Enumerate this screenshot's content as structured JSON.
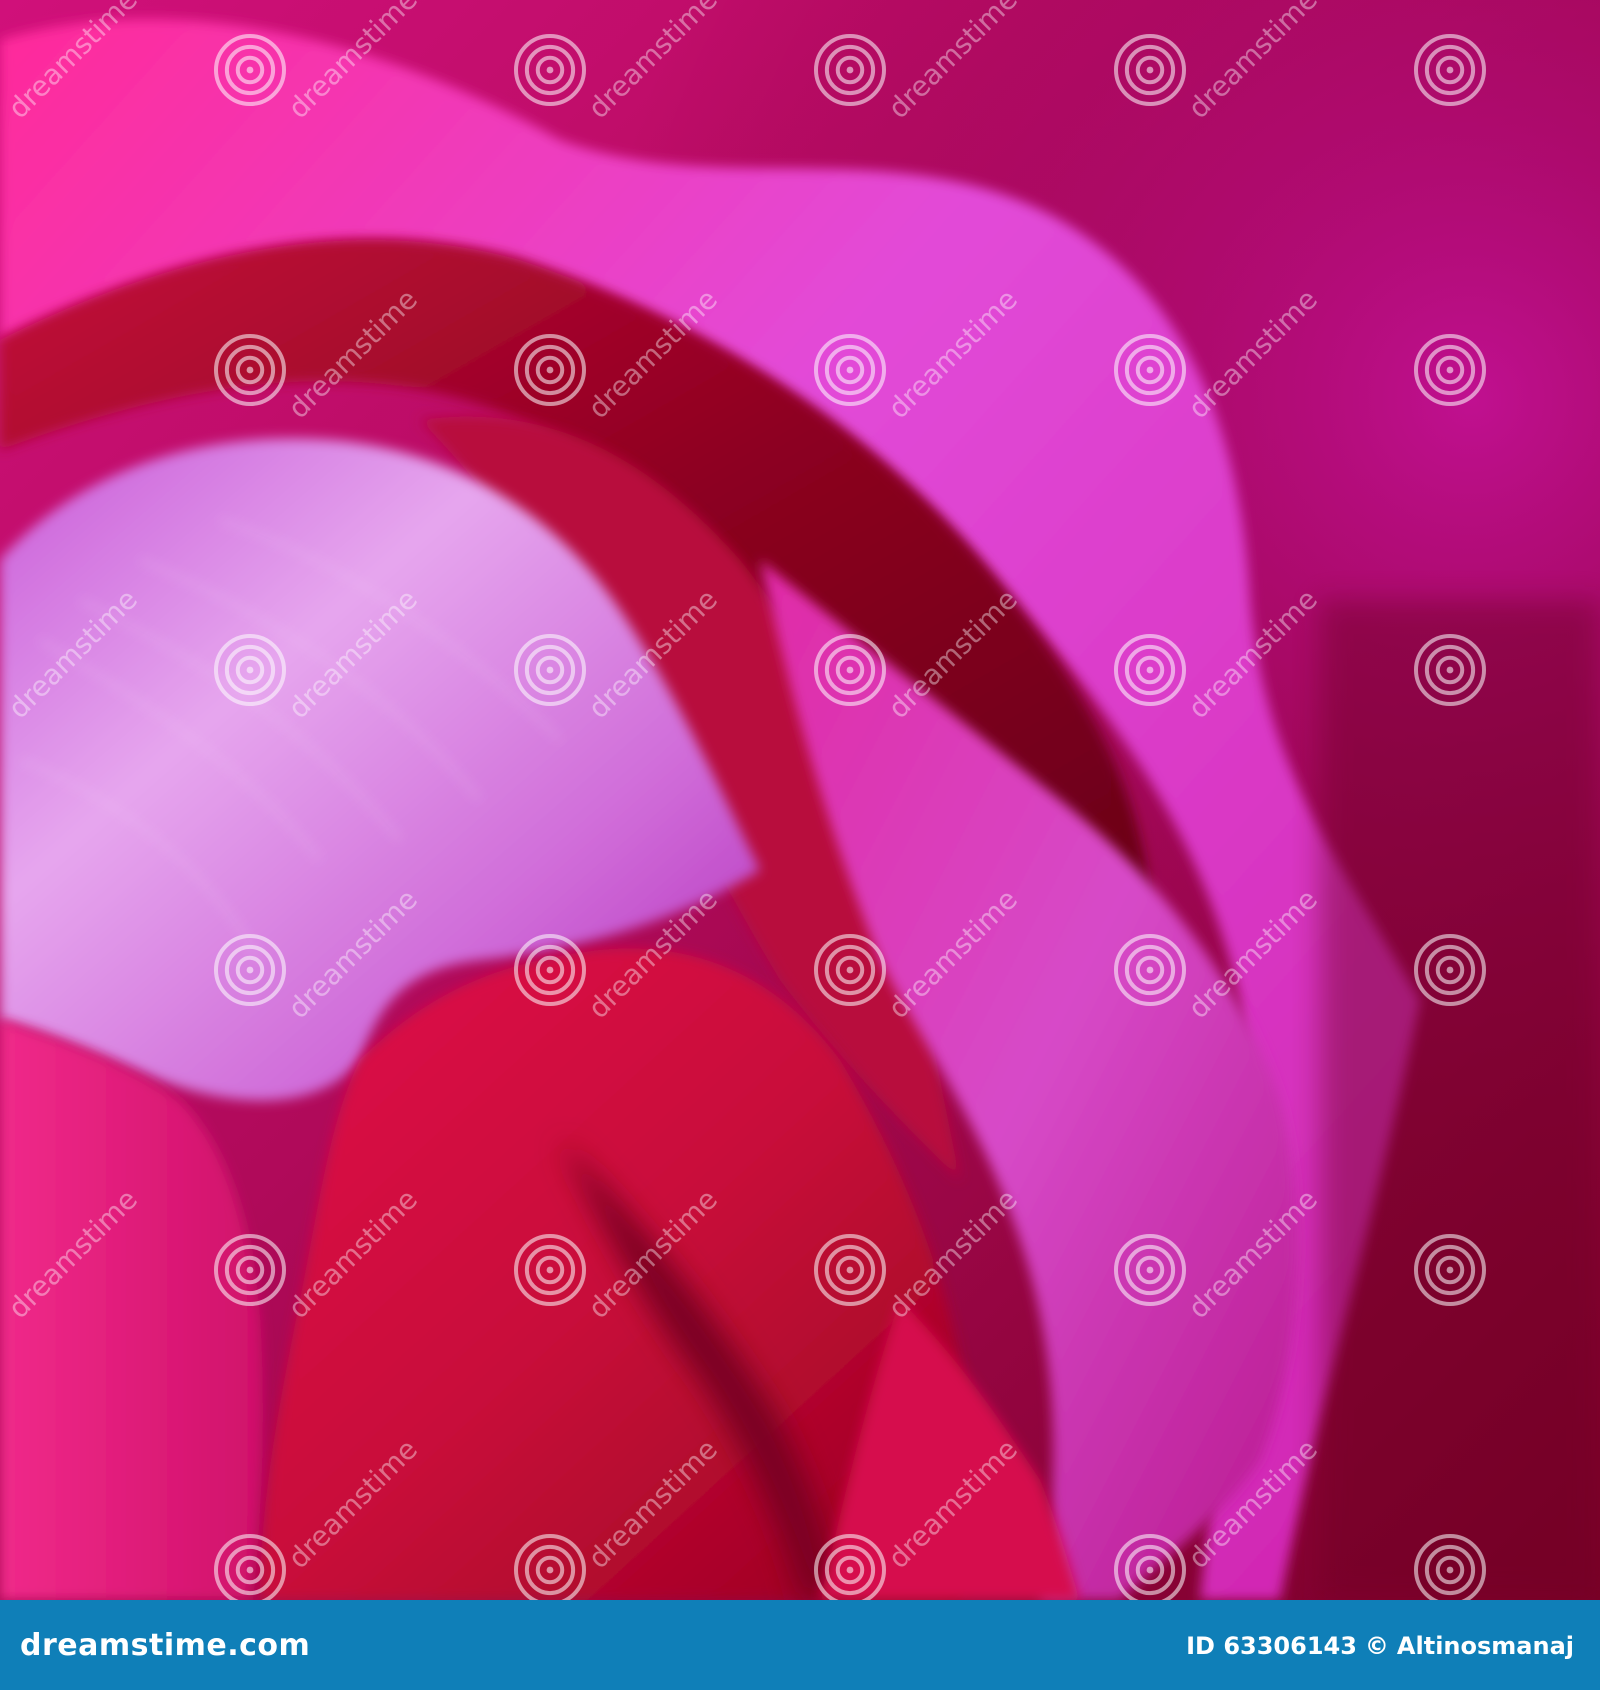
{
  "image": {
    "subject": "rose-petals-macro",
    "palette": {
      "deep": "#6e0020",
      "crimson": "#c0103a",
      "magenta": "#e0179a",
      "orchid": "#d66ae0",
      "highlight": "#f2b6f0",
      "background": "#a0006a"
    }
  },
  "watermark": {
    "text": "dreamstime",
    "icon": "spiral-logo-icon"
  },
  "footer": {
    "brand": "dreamstime.com",
    "id_label": "ID 63306143",
    "copyright_symbol": "©",
    "author": "Altinosmanaj",
    "bar_color": "#0f7fb8"
  }
}
